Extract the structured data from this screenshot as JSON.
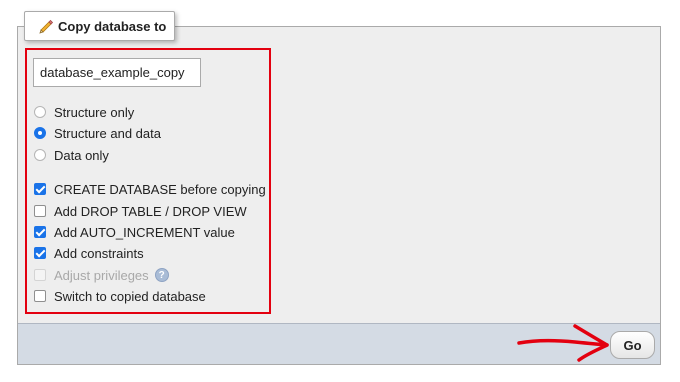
{
  "legend": {
    "icon": "pencil-icon",
    "title": "Copy database to"
  },
  "name_input": {
    "value": "database_example_copy"
  },
  "radios": [
    {
      "label": "Structure only",
      "checked": false
    },
    {
      "label": "Structure and data",
      "checked": true
    },
    {
      "label": "Data only",
      "checked": false
    }
  ],
  "checkboxes": [
    {
      "label": "CREATE DATABASE before copying",
      "checked": true,
      "disabled": false
    },
    {
      "label": "Add DROP TABLE / DROP VIEW",
      "checked": false,
      "disabled": false
    },
    {
      "label": "Add AUTO_INCREMENT value",
      "checked": true,
      "disabled": false
    },
    {
      "label": "Add constraints",
      "checked": true,
      "disabled": false
    },
    {
      "label": "Adjust privileges",
      "checked": false,
      "disabled": true
    },
    {
      "label": "Switch to copied database",
      "checked": false,
      "disabled": false
    }
  ],
  "help_icon": "help-icon",
  "go_button": {
    "label": "Go"
  },
  "colors": {
    "accent": "#1a73e8",
    "highlight_border": "#e3000f",
    "annotation_arrow": "#e3000f",
    "panel_bg": "#eeeeee",
    "footer_bg": "#d4dbe4"
  }
}
